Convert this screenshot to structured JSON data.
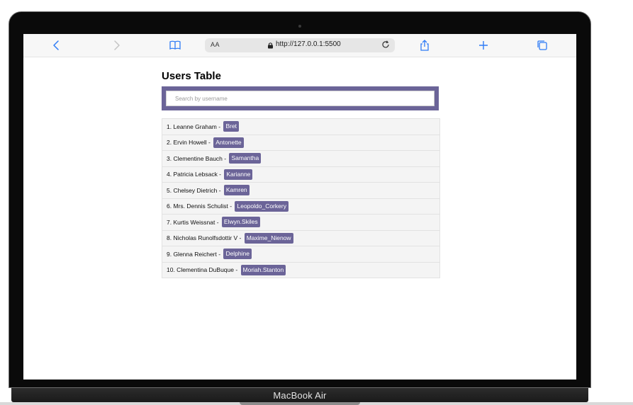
{
  "device": {
    "model_label": "MacBook Air"
  },
  "browser": {
    "text_size_label": "AA",
    "url": "http://127.0.0.1:5500"
  },
  "page": {
    "title": "Users Table",
    "search": {
      "placeholder": "Search by username",
      "value": ""
    },
    "users": [
      {
        "label": "1. Leanne Graham - ",
        "username": "Bret"
      },
      {
        "label": "2. Ervin Howell - ",
        "username": "Antonette"
      },
      {
        "label": "3. Clementine Bauch - ",
        "username": "Samantha"
      },
      {
        "label": "4. Patricia Lebsack - ",
        "username": "Karianne"
      },
      {
        "label": "5. Chelsey Dietrich - ",
        "username": "Kamren"
      },
      {
        "label": "6. Mrs. Dennis Schulist - ",
        "username": "Leopoldo_Corkery"
      },
      {
        "label": "7. Kurtis Weissnat - ",
        "username": "Elwyn.Skiles"
      },
      {
        "label": "8. Nicholas Runolfsdottir V - ",
        "username": "Maxime_Nienow"
      },
      {
        "label": "9. Glenna Reichert - ",
        "username": "Delphine"
      },
      {
        "label": "10. Clementina DuBuque - ",
        "username": "Moriah.Stanton"
      }
    ]
  },
  "colors": {
    "accent": "#6b6498",
    "icon_blue": "#2f7cf6"
  },
  "icons": [
    "back-icon",
    "forward-icon",
    "bookmarks-icon",
    "lock-icon",
    "reload-icon",
    "share-icon",
    "new-tab-icon",
    "tabs-icon"
  ]
}
